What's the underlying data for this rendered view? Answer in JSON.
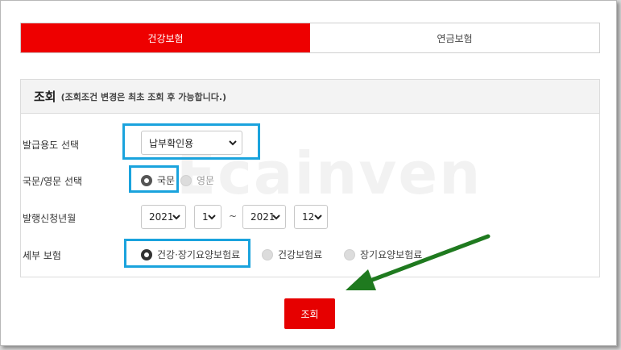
{
  "tabs": [
    {
      "label": "건강보험",
      "active": true
    },
    {
      "label": "연금보험",
      "active": false
    }
  ],
  "panel": {
    "title": "조회",
    "note": "(조회조건 변경은 최초 조회 후 가능합니다.)"
  },
  "watermark": "Ecainven",
  "form": {
    "purpose": {
      "label": "발급용도 선택",
      "value": "납부확인용"
    },
    "language": {
      "label": "국문/영문 선택",
      "options": [
        "국문",
        "영문"
      ],
      "selected": "국문"
    },
    "period": {
      "label": "발행신청년월",
      "from_year": "2021",
      "from_month": "1",
      "separator": "~",
      "to_year": "2021",
      "to_month": "12"
    },
    "detail": {
      "label": "세부 보험",
      "options": [
        "건강·장기요양보험료",
        "건강보험료",
        "장기요양보험료"
      ],
      "selected": "건강·장기요양보험료"
    }
  },
  "submit_label": "조회",
  "colors": {
    "accent": "#ee0000",
    "highlight": "#1aa3dd",
    "annotation_arrow": "#1f7a1f"
  }
}
